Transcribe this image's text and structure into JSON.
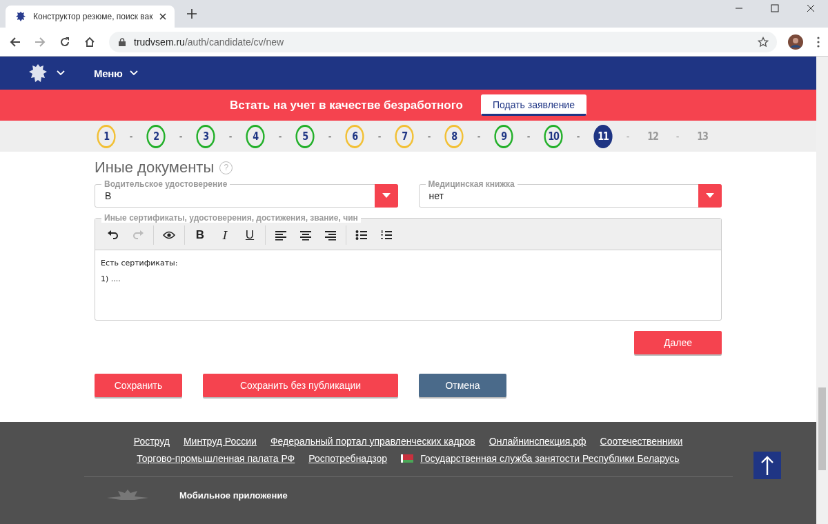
{
  "browser": {
    "tab_title": "Конструктор резюме, поиск вак",
    "url_host": "trudvsem.ru",
    "url_path": "/auth/candidate/cv/new"
  },
  "header": {
    "menu_label": "Меню"
  },
  "banner": {
    "text": "Встать на учет в качестве безработного",
    "button": "Подать заявление"
  },
  "steps": [
    {
      "label": "1",
      "kind": "partial"
    },
    {
      "dash": "-",
      "label": "2",
      "kind": "done"
    },
    {
      "dash": "-",
      "label": "3",
      "kind": "done"
    },
    {
      "dash": "-",
      "label": "4",
      "kind": "done"
    },
    {
      "dash": "-",
      "label": "5",
      "kind": "done"
    },
    {
      "dash": "-",
      "label": "6",
      "kind": "partial"
    },
    {
      "dash": "-",
      "label": "7",
      "kind": "partial"
    },
    {
      "dash": "-",
      "label": "8",
      "kind": "partial"
    },
    {
      "dash": "-",
      "label": "9",
      "kind": "done"
    },
    {
      "dash": "-",
      "label": "10",
      "kind": "done"
    },
    {
      "dash": "-",
      "label": "11",
      "kind": "current"
    },
    {
      "dash": "-",
      "label": "12",
      "kind": "future"
    },
    {
      "dash": "-",
      "label": "13",
      "kind": "future"
    }
  ],
  "section": {
    "title": "Иные документы",
    "help": "?"
  },
  "selects": [
    {
      "label": "Водительское удостоверение",
      "value": "В"
    },
    {
      "label": "Медицинская книжка",
      "value": "нет"
    }
  ],
  "editor": {
    "label": "Иные сертификаты, удостоверения, достижения, звание, чин",
    "toolbar_groups": [
      [
        {
          "kind": "undo",
          "disabled": false
        },
        {
          "kind": "redo",
          "disabled": true
        }
      ],
      [
        {
          "kind": "preview",
          "disabled": false
        }
      ],
      [
        {
          "kind": "bold",
          "label": "B",
          "disabled": false
        },
        {
          "kind": "italic",
          "label": "I",
          "disabled": false
        },
        {
          "kind": "underline",
          "label": "U",
          "disabled": false
        }
      ],
      [
        {
          "kind": "align-left",
          "disabled": false
        },
        {
          "kind": "align-center",
          "disabled": false
        },
        {
          "kind": "align-right",
          "disabled": false
        }
      ],
      [
        {
          "kind": "bullets",
          "disabled": false
        },
        {
          "kind": "numbers",
          "disabled": false
        }
      ]
    ],
    "lines": [
      "Есть сертификаты:",
      "1) ...."
    ]
  },
  "next_button": "Далее",
  "actions": [
    {
      "label": "Сохранить",
      "kind": "primary"
    },
    {
      "label": "Сохранить без публикации",
      "kind": "primary"
    },
    {
      "label": "Отмена",
      "kind": "secondary"
    }
  ],
  "footer": {
    "link_rows": [
      [
        {
          "label": "Роструд",
          "flag": false
        },
        {
          "label": "Минтруд России",
          "flag": false
        },
        {
          "label": "Федеральный портал управленческих кадров",
          "flag": false
        },
        {
          "label": "Онлайнинспекция.рф",
          "flag": false
        },
        {
          "label": "Соотечественники",
          "flag": false
        }
      ],
      [
        {
          "label": "Торгово-промышленная палата РФ",
          "flag": false
        },
        {
          "label": "Роспотребнадзор",
          "flag": false
        },
        {
          "label": "Государственная служба занятости Республики Беларусь",
          "flag": true
        }
      ]
    ],
    "app_title": "Мобильное приложение"
  }
}
